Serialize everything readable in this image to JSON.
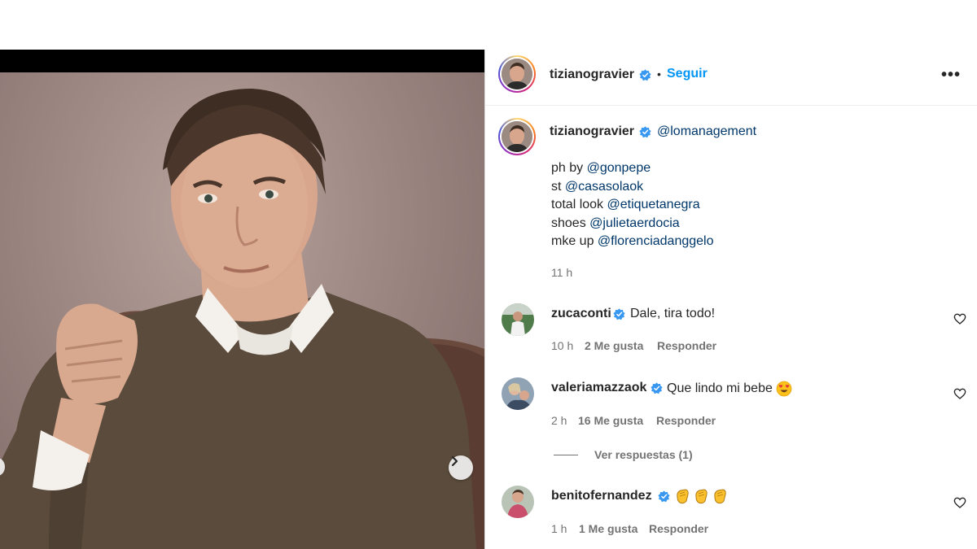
{
  "post": {
    "author": "tizianogravier",
    "follow_label": "Seguir",
    "separator": "•",
    "more_label": "•••"
  },
  "caption": {
    "author": "tizianogravier",
    "first_mention": "@lomanagement",
    "lines": [
      {
        "prefix": "ph by ",
        "mention": "@gonpepe"
      },
      {
        "prefix": "st ",
        "mention": "@casasolaok"
      },
      {
        "prefix": "total look ",
        "mention": "@etiquetanegra"
      },
      {
        "prefix": "shoes ",
        "mention": "@julietaerdocia"
      },
      {
        "prefix": "mke up ",
        "mention": "@florenciadanggelo"
      }
    ],
    "time": "11 h"
  },
  "comments": [
    {
      "user": "zucaconti",
      "text": "Dale, tira todo!",
      "time": "10 h",
      "likes": "2 Me gusta",
      "reply": "Responder"
    },
    {
      "user": "valeriamazzaok",
      "text": "Que lindo mi bebe",
      "emoji": "heart-eyes-emoji",
      "time": "2 h",
      "likes": "16 Me gusta",
      "reply": "Responder",
      "view_replies": "Ver respuestas (1)"
    },
    {
      "user": "benitofernandez",
      "text": "",
      "emoji": "clapping-hands-emoji",
      "time": "1 h",
      "likes": "1 Me gusta",
      "reply": "Responder"
    }
  ],
  "colors": {
    "link_blue": "#0095f6",
    "mention_blue": "#00376b",
    "verified_blue": "#3897f0",
    "muted": "#737373",
    "text": "#262626"
  },
  "icons": [
    "verified-badge-icon",
    "heart-icon",
    "chevron-right-icon",
    "more-options-icon"
  ]
}
